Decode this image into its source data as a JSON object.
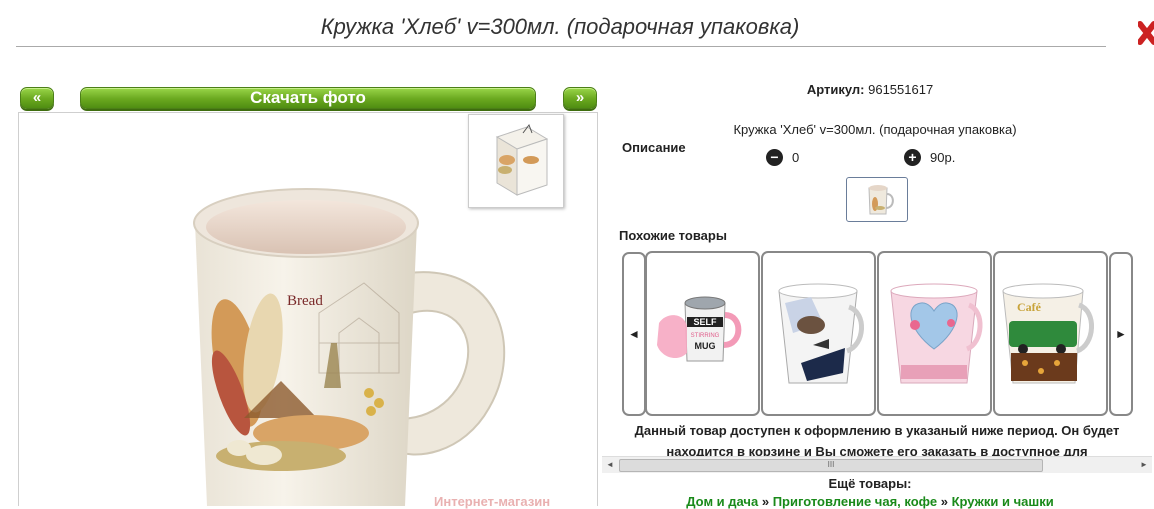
{
  "page": {
    "title": "Кружка 'Хлеб' v=300мл. (подарочная упаковка)"
  },
  "gallery": {
    "prev_label": "«",
    "download_label": "Скачать фото",
    "next_label": "»",
    "mug_text": "Bread",
    "watermark": "Интернет-магазин"
  },
  "product": {
    "article_label": "Артикул:",
    "article_value": "961551617",
    "description_label": "Описание",
    "description_text": "Кружка 'Хлеб' v=300мл. (подарочная упаковка)",
    "minus_value": "0",
    "plus_value": "90р."
  },
  "similar": {
    "title": "Похожие товары",
    "left_arrow": "◄",
    "right_arrow": "►",
    "card1_text": [
      "SELF",
      "STIRRING",
      "MUG"
    ],
    "card4_text": "Café"
  },
  "availability": {
    "text": "Данный товар доступен к оформлению в указаный ниже период. Он будет находится в корзине и Вы сможете его заказать в доступное для",
    "scroll_thumb": "III",
    "scroll_left": "◄",
    "scroll_right": "►"
  },
  "more": {
    "title": "Ещё товары:",
    "crumbs": [
      "Дом и дача",
      "Приготовление чая, кофе",
      "Кружки и чашки"
    ],
    "sep": "»"
  },
  "colors": {
    "accent_green": "#6aa81f",
    "link_green": "#1a8a1a",
    "close_red": "#cc2222"
  }
}
